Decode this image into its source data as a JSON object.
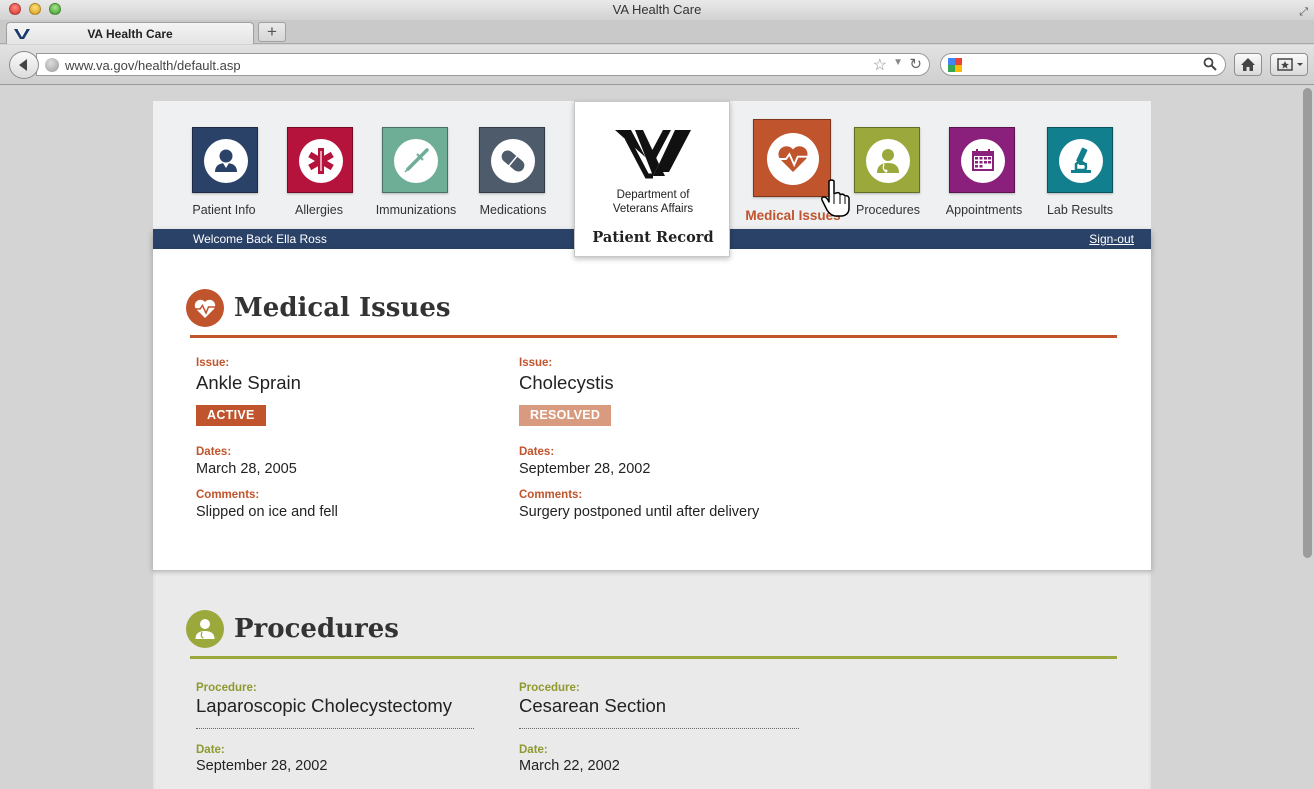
{
  "browser": {
    "window_title": "VA Health Care",
    "tab_title": "VA Health Care",
    "new_tab_label": "+",
    "url": "www.va.gov/health/default.asp"
  },
  "site": {
    "nav": [
      {
        "label": "Patient Info",
        "color": "#2b4268",
        "icon": "person-icon"
      },
      {
        "label": "Allergies",
        "color": "#b5123c",
        "icon": "medical-star-icon"
      },
      {
        "label": "Immunizations",
        "color": "#6fae96",
        "icon": "syringe-icon"
      },
      {
        "label": "Medications",
        "color": "#4d5b6b",
        "icon": "pill-icon"
      },
      {
        "label": "Medical Issues",
        "color": "#c0542c",
        "icon": "heart-pulse-icon",
        "active": true
      },
      {
        "label": "Procedures",
        "color": "#9aa83c",
        "icon": "doctor-icon"
      },
      {
        "label": "Appointments",
        "color": "#8a1f7c",
        "icon": "calendar-icon"
      },
      {
        "label": "Lab Results",
        "color": "#127f8e",
        "icon": "microscope-icon"
      }
    ],
    "logo": {
      "dept_line1": "Department of",
      "dept_line2": "Veterans Affairs",
      "patient_record": "Patient Record"
    },
    "welcome": "Welcome Back Ella Ross",
    "signout": "Sign-out"
  },
  "medical_issues": {
    "title": "Medical Issues",
    "accent": "#c0542c",
    "items": [
      {
        "issue_label": "Issue:",
        "issue": "Ankle Sprain",
        "status": "ACTIVE",
        "status_color": "#c0542c",
        "dates_label": "Dates:",
        "dates": "March 28, 2005",
        "comments_label": "Comments:",
        "comments": "Slipped on ice and fell"
      },
      {
        "issue_label": "Issue:",
        "issue": "Cholecystis",
        "status": "RESOLVED",
        "status_color": "#d99b80",
        "dates_label": "Dates:",
        "dates": "September 28, 2002",
        "comments_label": "Comments:",
        "comments": "Surgery postponed until after delivery"
      }
    ]
  },
  "procedures": {
    "title": "Procedures",
    "accent": "#9aa83c",
    "items": [
      {
        "procedure_label": "Procedure:",
        "procedure": "Laparoscopic Cholecystectomy",
        "date_label": "Date:",
        "date": "September 28, 2002"
      },
      {
        "procedure_label": "Procedure:",
        "procedure": "Cesarean Section",
        "date_label": "Date:",
        "date": "March 22, 2002"
      }
    ]
  }
}
